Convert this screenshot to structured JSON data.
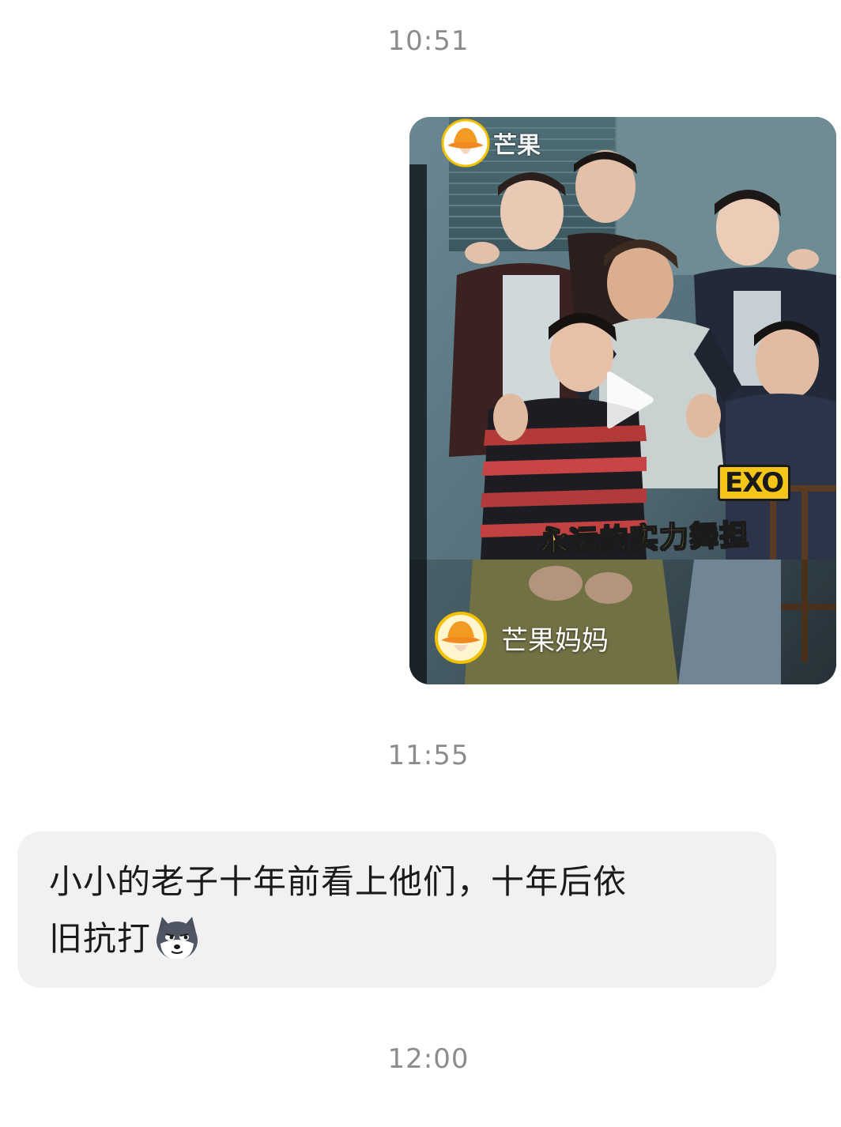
{
  "timestamps": {
    "first": "10:51",
    "second": "11:55",
    "third": "12:00"
  },
  "video_message": {
    "brand_watermark": "芒果",
    "badge": "EXO",
    "caption": "永远的实力舞担",
    "channel_name": "芒果妈妈",
    "play_icon": "play-icon",
    "avatar_icon": "mango-hat-avatar-icon"
  },
  "text_message": {
    "line1": "小小的老子十年前看上他们，十年后依",
    "line2": "旧抗打",
    "emoji": "husky-emoji"
  },
  "colors": {
    "bubble_background": "#f1f1f1",
    "timestamp_text": "#8c8c8c",
    "caption_yellow": "#f6d64a",
    "badge_yellow": "#f5c518"
  }
}
